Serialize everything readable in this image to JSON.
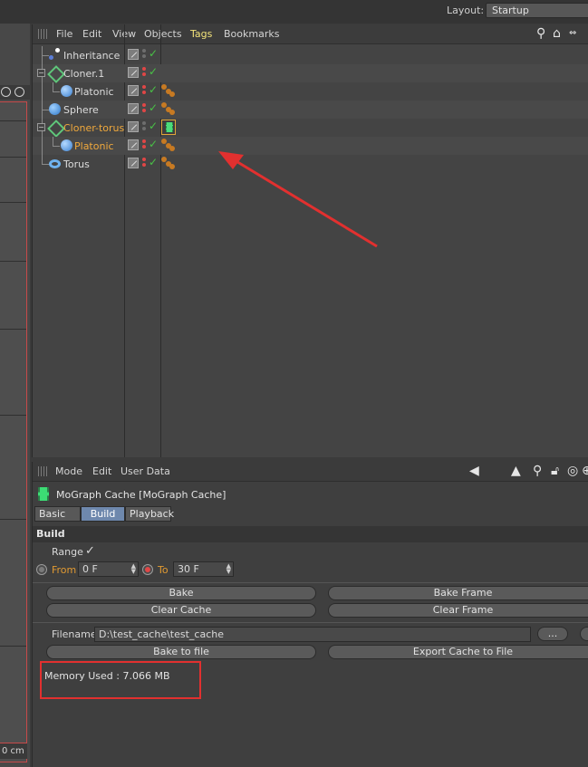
{
  "layout": {
    "label": "Layout:",
    "value": "Startup"
  },
  "viewport": {
    "unit_text": "0 cm"
  },
  "object_manager": {
    "menu": [
      "File",
      "Edit",
      "View",
      "Objects",
      "Tags",
      "Bookmarks"
    ],
    "active_menu": "Tags",
    "objects": [
      {
        "name": "Inheritance",
        "icon": "null-effector-icon"
      },
      {
        "name": "Cloner.1",
        "icon": "cloner-icon"
      },
      {
        "name": "Platonic",
        "icon": "platonic-icon"
      },
      {
        "name": "Sphere",
        "icon": "sphere-icon"
      },
      {
        "name": "Cloner-torus",
        "icon": "cloner-icon",
        "selected": true
      },
      {
        "name": "Platonic",
        "icon": "platonic-icon",
        "selected": true
      },
      {
        "name": "Torus",
        "icon": "torus-icon"
      }
    ]
  },
  "attribute_manager": {
    "menu": [
      "Mode",
      "Edit",
      "User Data"
    ],
    "title": "MoGraph Cache [MoGraph Cache]",
    "tabs": [
      "Basic",
      "Build",
      "Playback"
    ],
    "active_tab": "Build",
    "section": "Build",
    "range_label": "Range",
    "range_check": "✓",
    "from_label": "From",
    "from_value": "0 F",
    "to_label": "To",
    "to_value": "30 F",
    "buttons": {
      "bake": "Bake",
      "bake_frame": "Bake Frame",
      "clear_cache": "Clear Cache",
      "clear_frame": "Clear Frame",
      "browse": "...",
      "bake_to_file": "Bake to file",
      "export_cache": "Export Cache to File"
    },
    "filename_label": "Filename",
    "filename_value": "D:\\test_cache\\test_cache",
    "memory_used": "Memory Used : 7.066 MB"
  },
  "colors": {
    "accent_selected": "#f0a93c",
    "annotation": "#e2302f",
    "tab_active": "#6e88ad"
  }
}
